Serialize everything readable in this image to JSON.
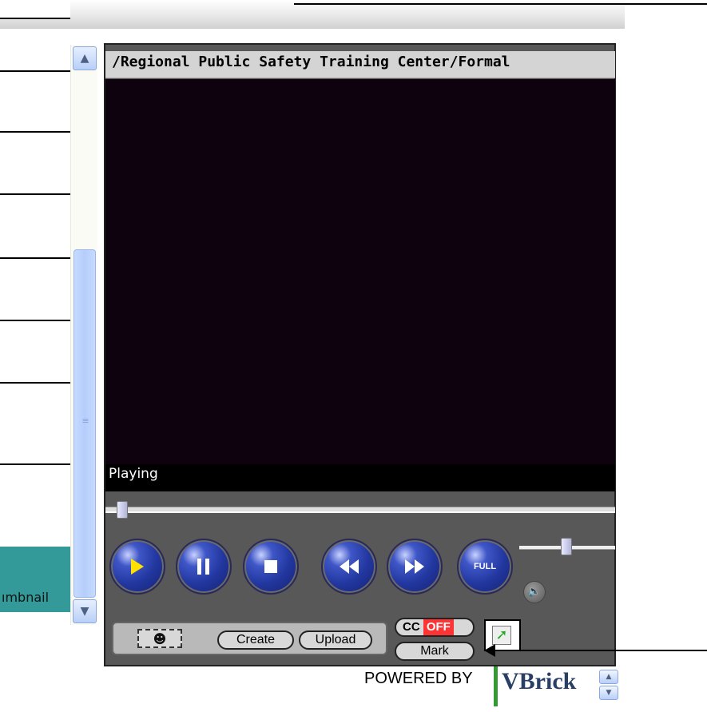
{
  "player": {
    "title": "/Regional Public Safety Training Center/Formal",
    "status": "Playing",
    "seek_progress": 0.02,
    "volume_level": 0.45,
    "full_label": "FULL"
  },
  "left_panel": {
    "thumbnail_label": "ımbnail"
  },
  "controls": {
    "play": "play-button",
    "pause": "pause-button",
    "stop": "stop-button",
    "rewind": "rewind-button",
    "fast_forward": "fast-forward-button",
    "fullscreen": "fullscreen-button"
  },
  "thumbnail_tools": {
    "create_label": "Create",
    "upload_label": "Upload"
  },
  "captions": {
    "cc_label": "CC",
    "cc_state": "OFF",
    "mark_label": "Mark"
  },
  "footer": {
    "powered_by": "POWERED BY",
    "brand": "VBrick"
  },
  "colors": {
    "teal": "#339999",
    "video_bg": "#0e020e",
    "button_blue": "#22379f",
    "cc_off": "#ff3333",
    "brand_green": "#339933"
  }
}
